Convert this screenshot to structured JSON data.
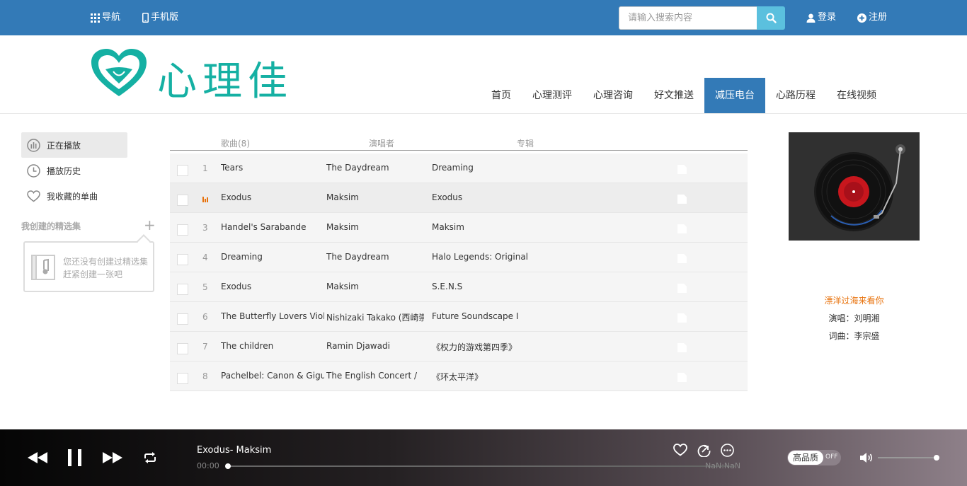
{
  "topbar": {
    "nav_label": "导航",
    "mobile_label": "手机版",
    "search_placeholder": "请输入搜索内容",
    "login_label": "登录",
    "register_label": "注册",
    "bg_color": "#337ab7"
  },
  "header": {
    "logo_text": "心理佳",
    "logo_color": "#15b0a3",
    "nav": [
      "首页",
      "心理测评",
      "心理咨询",
      "好文推送",
      "减压电台",
      "心路历程",
      "在线视频"
    ],
    "active_nav": "减压电台"
  },
  "sidebar": {
    "items": [
      {
        "label": "正在播放",
        "icon": "equalizer-icon",
        "active": true
      },
      {
        "label": "播放历史",
        "icon": "clock-icon",
        "active": false
      },
      {
        "label": "我收藏的单曲",
        "icon": "heart-icon",
        "active": false
      }
    ],
    "my_collections_title": "我创建的精选集",
    "empty_message": "您还没有创建过精选集赶紧创建一张吧"
  },
  "playlist": {
    "headers": {
      "song": "歌曲(8)",
      "artist": "演唱者",
      "album": "专辑"
    },
    "rows": [
      {
        "index": "1",
        "song": "Tears",
        "artist": "The Daydream",
        "album": "Dreaming",
        "playing": false
      },
      {
        "index": "2",
        "song": "Exodus",
        "artist": "Maksim",
        "album": "Exodus",
        "playing": true
      },
      {
        "index": "3",
        "song": "Handel's Sarabande",
        "artist": "Maksim",
        "album": "Maksim",
        "playing": false
      },
      {
        "index": "4",
        "song": "Dreaming",
        "artist": "The Daydream",
        "album": "Halo Legends: Original",
        "playing": false
      },
      {
        "index": "5",
        "song": "Exodus",
        "artist": "Maksim",
        "album": "S.E.N.S",
        "playing": false
      },
      {
        "index": "6",
        "song": "The Butterfly Lovers Violin",
        "artist": "Nishizaki Takako (西崎崇",
        "album": "Future Soundscape I",
        "playing": false
      },
      {
        "index": "7",
        "song": "The children",
        "artist": "Ramin Djawadi",
        "album": "《权力的游戏第四季》",
        "playing": false
      },
      {
        "index": "8",
        "song": "Pachelbel: Canon & Gigue,",
        "artist": "The English Concert /",
        "album": "《环太平洋》",
        "playing": false
      }
    ]
  },
  "now_playing": {
    "lyric_title": "漂洋过海来看你",
    "singer_line": "演唱：刘明湘",
    "lyricist_line": "词曲：李宗盛",
    "accent_color": "#e8720c"
  },
  "player": {
    "title": "Exodus- Maksim",
    "current_time": "00:00",
    "duration": "NaN:NaN",
    "progress": 0,
    "quality_label": "高品质",
    "quality_toggle": "OFF",
    "volume": 1.0
  }
}
